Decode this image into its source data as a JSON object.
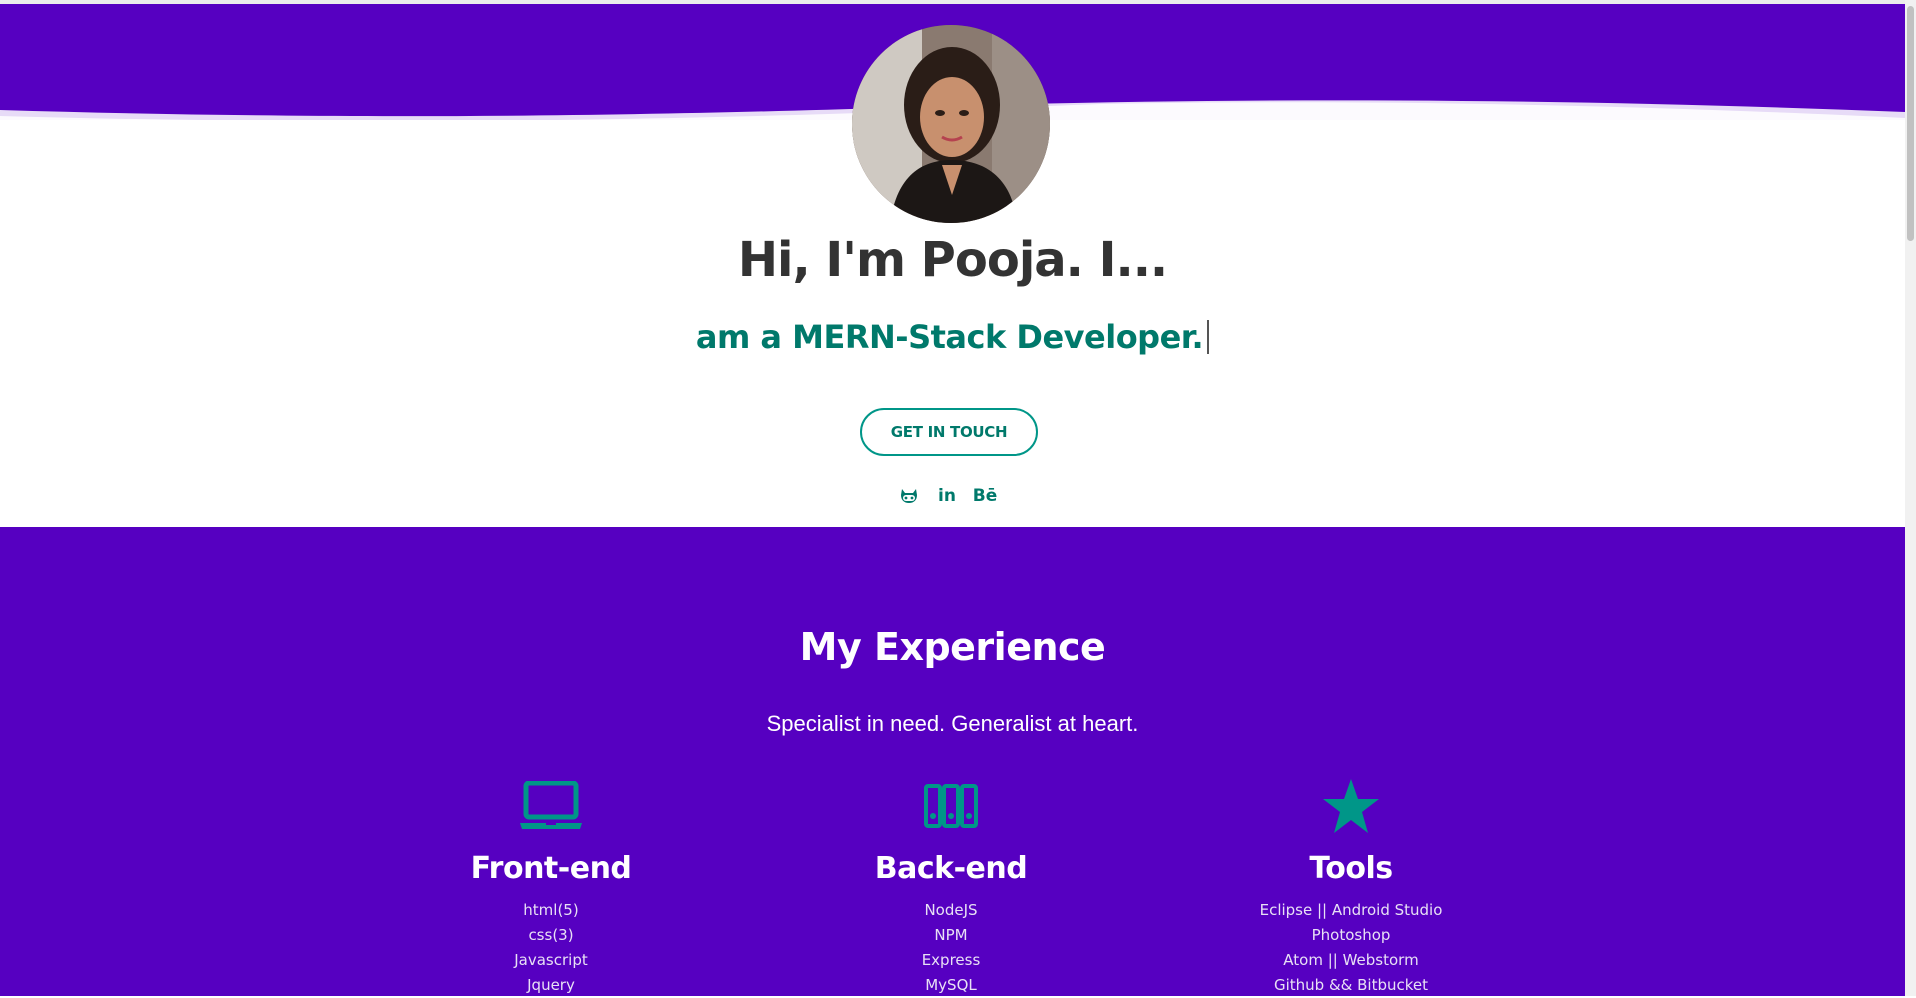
{
  "hero": {
    "heading": "Hi, I'm Pooja. I...",
    "typed_text": "am a MERN-Stack Developer.",
    "cta_label": "GET IN TOUCH",
    "socials": [
      {
        "icon": "github-icon"
      },
      {
        "icon": "linkedin-icon",
        "glyph": "in"
      },
      {
        "icon": "behance-icon",
        "glyph": "Bē"
      }
    ]
  },
  "experience": {
    "title": "My Experience",
    "subtitle": "Specialist in need. Generalist at heart.",
    "columns": [
      {
        "icon": "laptop-icon",
        "title": "Front-end",
        "items": [
          "html(5)",
          "css(3)",
          "Javascript",
          "Jquery"
        ]
      },
      {
        "icon": "server-icon",
        "title": "Back-end",
        "items": [
          "NodeJS",
          "NPM",
          "Express",
          "MySQL"
        ]
      },
      {
        "icon": "star-icon",
        "title": "Tools",
        "items": [
          "Eclipse || Android Studio",
          "Photoshop",
          "Atom || Webstorm",
          "Github && Bitbucket"
        ]
      }
    ]
  },
  "colors": {
    "primary_purple": "#5600c1",
    "accent_teal": "#009688",
    "heading_dark": "#333333"
  }
}
